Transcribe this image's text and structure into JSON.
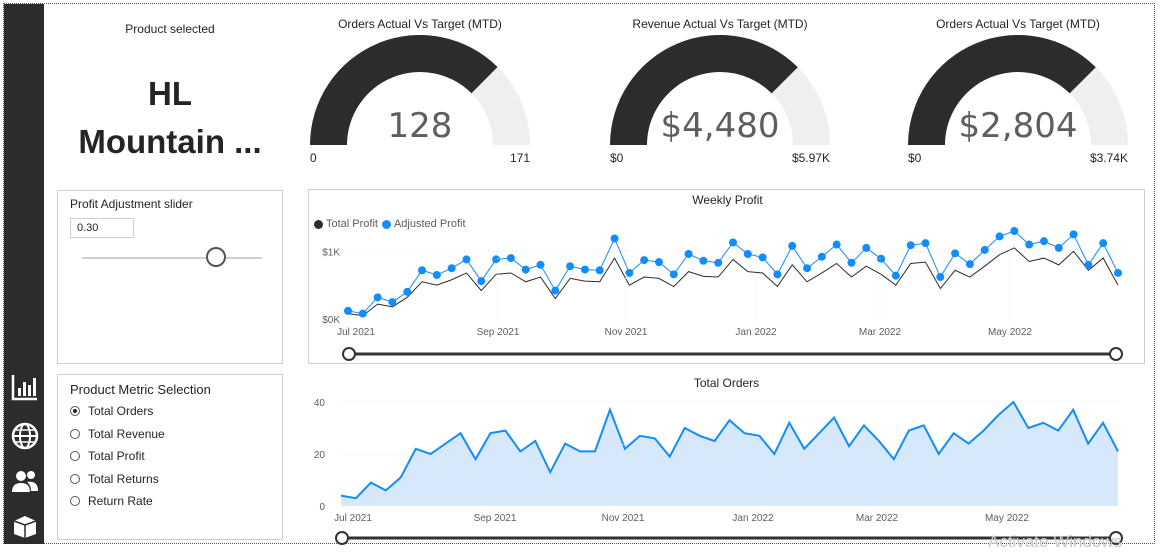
{
  "sidebar": {
    "icons": [
      "bar-chart-icon",
      "globe-icon",
      "people-icon",
      "box-icon"
    ]
  },
  "product_card": {
    "label": "Product selected",
    "value_line1": "HL",
    "value_line2": "Mountain ..."
  },
  "gauges": [
    {
      "title": "Orders Actual Vs Target (MTD)",
      "value": "128",
      "min": "0",
      "max": "171",
      "fraction": 0.749
    },
    {
      "title": "Revenue Actual Vs Target (MTD)",
      "value": "$4,480",
      "min": "$0",
      "max": "$5.97K",
      "fraction": 0.75
    },
    {
      "title": "Orders Actual Vs Target (MTD)",
      "value": "$2,804",
      "min": "$0",
      "max": "$3.74K",
      "fraction": 0.75
    }
  ],
  "slider": {
    "title": "Profit Adjustment slider",
    "value": "0.30",
    "fraction": 0.3
  },
  "metric_selection": {
    "title": "Product Metric Selection",
    "options": [
      "Total Orders",
      "Total Revenue",
      "Total Profit",
      "Total Returns",
      "Return Rate"
    ],
    "selected": 0
  },
  "colors": {
    "dark": "#2c2c2c",
    "accent": "#118dff",
    "area": "#d7e8fb",
    "track": "#f0efee"
  },
  "weekly_profit": {
    "title": "Weekly Profit",
    "legend": [
      "Total Profit",
      "Adjusted Profit"
    ]
  },
  "total_orders": {
    "title": "Total Orders"
  },
  "watermark": "Activate Windows",
  "chart_data": [
    {
      "type": "line",
      "title": "Weekly Profit",
      "x_ticks": [
        "Jul 2021",
        "Sep 2021",
        "Nov 2021",
        "Jan 2022",
        "Mar 2022",
        "May 2022"
      ],
      "y_ticks": [
        "$0K",
        "$1K"
      ],
      "ylim": [
        0,
        1.3
      ],
      "series": [
        {
          "name": "Total Profit",
          "values": [
            0.08,
            0.05,
            0.22,
            0.18,
            0.32,
            0.55,
            0.5,
            0.58,
            0.68,
            0.42,
            0.66,
            0.68,
            0.55,
            0.62,
            0.3,
            0.6,
            0.56,
            0.55,
            0.9,
            0.5,
            0.62,
            0.6,
            0.48,
            0.7,
            0.63,
            0.62,
            0.88,
            0.7,
            0.68,
            0.48,
            0.8,
            0.55,
            0.68,
            0.82,
            0.62,
            0.78,
            0.66,
            0.5,
            0.82,
            0.84,
            0.45,
            0.72,
            0.62,
            0.78,
            0.95,
            1.05,
            0.85,
            0.9,
            0.8,
            1.0,
            0.72,
            0.9,
            0.5
          ]
        },
        {
          "name": "Adjusted Profit",
          "values": [
            0.12,
            0.08,
            0.32,
            0.25,
            0.4,
            0.72,
            0.65,
            0.75,
            0.88,
            0.56,
            0.88,
            0.9,
            0.73,
            0.8,
            0.42,
            0.78,
            0.73,
            0.72,
            1.19,
            0.68,
            0.87,
            0.84,
            0.66,
            0.96,
            0.86,
            0.83,
            1.13,
            0.96,
            0.91,
            0.66,
            1.08,
            0.75,
            0.92,
            1.1,
            0.83,
            1.05,
            0.89,
            0.64,
            1.09,
            1.12,
            0.62,
            0.97,
            0.81,
            1.02,
            1.22,
            1.3,
            1.1,
            1.15,
            1.05,
            1.25,
            0.8,
            1.12,
            0.68
          ]
        }
      ]
    },
    {
      "type": "area",
      "title": "Total Orders",
      "x_ticks": [
        "Jul 2021",
        "Sep 2021",
        "Nov 2021",
        "Jan 2022",
        "Mar 2022",
        "May 2022"
      ],
      "y_ticks": [
        "0",
        "20",
        "40"
      ],
      "ylim": [
        0,
        40
      ],
      "series": [
        {
          "name": "Total Orders",
          "values": [
            4,
            3,
            9,
            6,
            11,
            22,
            20,
            24,
            28,
            18,
            28,
            29,
            21,
            25,
            13,
            24,
            21,
            21,
            37,
            22,
            27,
            26,
            19,
            30,
            27,
            25,
            33,
            28,
            27,
            20,
            32,
            22,
            28,
            34,
            23,
            31,
            25,
            18,
            29,
            31,
            20,
            28,
            24,
            29,
            35,
            40,
            30,
            32,
            29,
            37,
            24,
            32,
            21
          ]
        }
      ]
    }
  ]
}
